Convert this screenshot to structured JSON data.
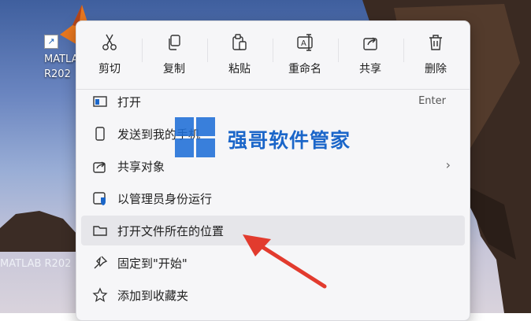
{
  "desktop": {
    "icon_label_line1": "MATLAB",
    "icon_label_line2": "R202",
    "taskbar_text": "MATLAB R202",
    "shortcut_arrow": "↗"
  },
  "actions": [
    {
      "label": "剪切",
      "icon": "cut-icon"
    },
    {
      "label": "复制",
      "icon": "copy-icon"
    },
    {
      "label": "粘贴",
      "icon": "paste-icon"
    },
    {
      "label": "重命名",
      "icon": "rename-icon"
    },
    {
      "label": "共享",
      "icon": "share-icon"
    },
    {
      "label": "删除",
      "icon": "delete-icon"
    }
  ],
  "items": [
    {
      "label": "打开",
      "shortcut": "Enter",
      "icon": "open-icon"
    },
    {
      "label": "发送到我的手机",
      "icon": "phone-icon"
    },
    {
      "label": "共享对象",
      "submenu": "›",
      "icon": "share-icon"
    },
    {
      "label": "以管理员身份运行",
      "icon": "admin-shield-icon"
    },
    {
      "label": "打开文件所在的位置",
      "icon": "folder-icon",
      "highlighted": true
    },
    {
      "label": "固定到\"开始\"",
      "icon": "pin-icon"
    },
    {
      "label": "添加到收藏夹",
      "icon": "star-icon"
    }
  ],
  "watermark": {
    "text": "强哥软件管家"
  },
  "colors": {
    "accent": "#1b66c9",
    "arrow": "#e23b2e",
    "menu_bg": "#f6f6f8"
  }
}
